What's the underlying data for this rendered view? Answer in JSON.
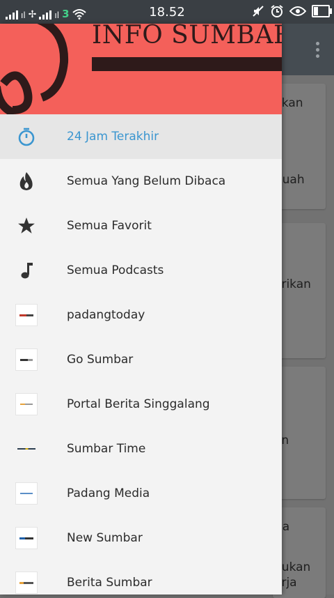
{
  "status_bar": {
    "network_1": "ıl",
    "network_2": "ıl",
    "time": "18.52",
    "battery_level": 0.35
  },
  "background_app": {
    "cards": [
      {
        "lines": [
          "hkan",
          "",
          "a",
          "Buah"
        ]
      },
      {
        "lines": [
          "erikan",
          "h"
        ]
      },
      {
        "lines": [
          "an"
        ]
      },
      {
        "lines": [
          "rja",
          "",
          "dukan",
          "erja"
        ]
      }
    ]
  },
  "drawer": {
    "header_title": "INFO SUMBAR",
    "header_bg_color": "#f4605a",
    "accent_color": "#3b96d0",
    "items": [
      {
        "label": "24 Jam Terakhir",
        "icon": "stopwatch-icon",
        "active": true
      },
      {
        "label": "Semua Yang Belum Dibaca",
        "icon": "flame-icon",
        "active": false
      },
      {
        "label": "Semua Favorit",
        "icon": "star-icon",
        "active": false
      },
      {
        "label": "Semua Podcasts",
        "icon": "music-note-icon",
        "active": false
      },
      {
        "label": "padangtoday",
        "icon": "padangtoday-logo-icon",
        "active": false
      },
      {
        "label": "Go Sumbar",
        "icon": "go-sumbar-logo-icon",
        "active": false
      },
      {
        "label": "Portal Berita Singgalang",
        "icon": "singgalang-logo-icon",
        "active": false
      },
      {
        "label": "Sumbar Time",
        "icon": "sumbar-time-logo-icon",
        "active": false
      },
      {
        "label": "Padang Media",
        "icon": "padang-media-logo-icon",
        "active": false
      },
      {
        "label": "New Sumbar",
        "icon": "new-sumbar-logo-icon",
        "active": false
      },
      {
        "label": "Berita Sumbar",
        "icon": "berita-sumbar-logo-icon",
        "active": false
      }
    ]
  }
}
